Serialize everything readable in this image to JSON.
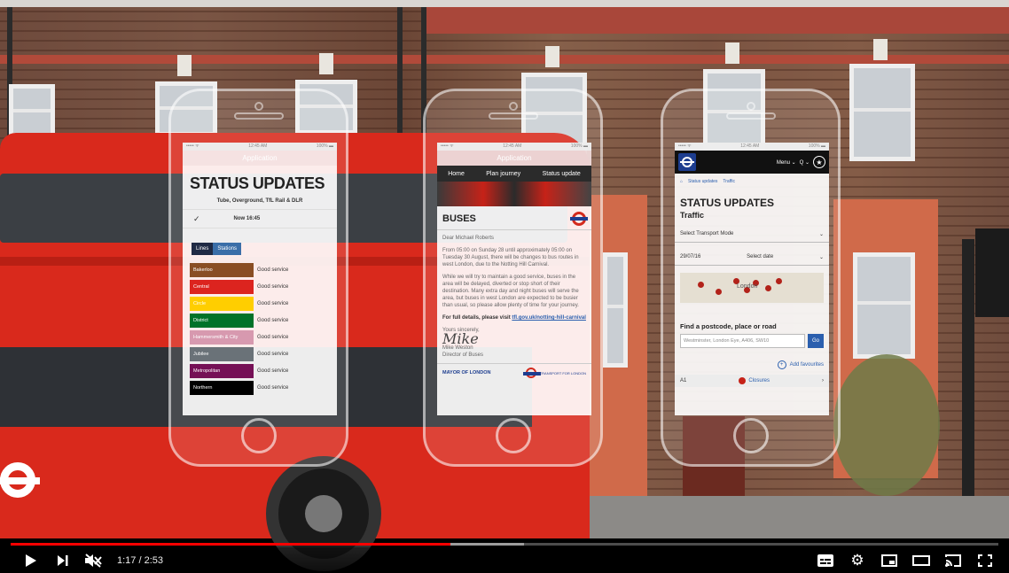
{
  "video": {
    "current_time": "1:17",
    "separator": " / ",
    "duration": "2:53",
    "played_fraction": 0.445,
    "buffered_fraction": 0.52,
    "accent_color": "#ff0000"
  },
  "controls": {
    "play_icon": "play-icon",
    "next_icon": "next-icon",
    "volume_icon": "volume-muted-icon",
    "right_icons": [
      "subtitles-icon",
      "settings-icon",
      "miniplayer-icon",
      "theater-mode-icon",
      "cast-icon",
      "fullscreen-icon"
    ]
  },
  "phone1": {
    "status_left": "••••• ᯤ",
    "status_center": "12:45 AM",
    "status_right": "100% ▬",
    "app_title": "Application",
    "title": "STATUS UPDATES",
    "subtitle": "Tube, Overground, TfL Rail & DLR",
    "now_label": "Now 16:45",
    "tab_lines": "Lines",
    "tab_stations": "Stations",
    "lines": [
      {
        "name": "Bakerloo",
        "status": "Good service",
        "color": "#894e24"
      },
      {
        "name": "Central",
        "status": "Good service",
        "color": "#dc241f"
      },
      {
        "name": "Circle",
        "status": "Good service",
        "color": "#ffce00"
      },
      {
        "name": "District",
        "status": "Good service",
        "color": "#007229"
      },
      {
        "name": "Hammersmith & City",
        "status": "Good service",
        "color": "#d799af"
      },
      {
        "name": "Jubilee",
        "status": "Good service",
        "color": "#6a7278"
      },
      {
        "name": "Metropolitan",
        "status": "Good service",
        "color": "#751056"
      },
      {
        "name": "Northern",
        "status": "Good service",
        "color": "#000000"
      }
    ]
  },
  "phone2": {
    "status_left": "••••• ᯤ",
    "status_center": "12:45 AM",
    "status_right": "100% ▬",
    "app_title": "Application",
    "nav": [
      "Home",
      "Plan journey",
      "Status update"
    ],
    "heading": "BUSES",
    "greeting": "Dear Michael Roberts",
    "para1": "From 05:00 on Sunday 28 until approximately 05:00 on Tuesday 30 August, there will be changes to bus routes in west London, due to the Notting Hill Carnival.",
    "para2": "While we will try to maintain a good service, buses in the area will be delayed, diverted or stop short of their destination. Many extra day and night buses will serve the area, but buses in west London are expected to be busier than usual, so please allow plenty of time for your journey.",
    "details_prefix": "For full details, please visit ",
    "details_link": "tfl.gov.uk/notting-hill-carnival",
    "signoff": "Yours sincerely,",
    "signature": "Mike",
    "sender_name": "Mike Weston",
    "sender_title": "Director of Buses",
    "footer_left": "MAYOR OF LONDON",
    "footer_right": "TRANSPORT FOR LONDON"
  },
  "phone3": {
    "status_left": "••••• ᯤ",
    "status_center": "12:45 AM",
    "status_right": "100% ▬",
    "menu": "Menu ⌄",
    "search": "Q ⌄",
    "star": "★",
    "crumb_home": "⌂",
    "crumb_1": "Status updates",
    "crumb_2": "Traffic",
    "title": "STATUS UPDATES",
    "subtitle": "Traffic",
    "select_mode": "Select Transport Mode",
    "date": "29/07/16",
    "select_date": "Select date",
    "map_label": "London",
    "find_label": "Find a postcode, place or road",
    "input_placeholder": "Westminster, London Eye, A406, SW10",
    "go": "Go",
    "add_favourites": "Add favourites",
    "bottom_left": "A1",
    "closures": "Closures",
    "bottom_arrow": "›"
  }
}
